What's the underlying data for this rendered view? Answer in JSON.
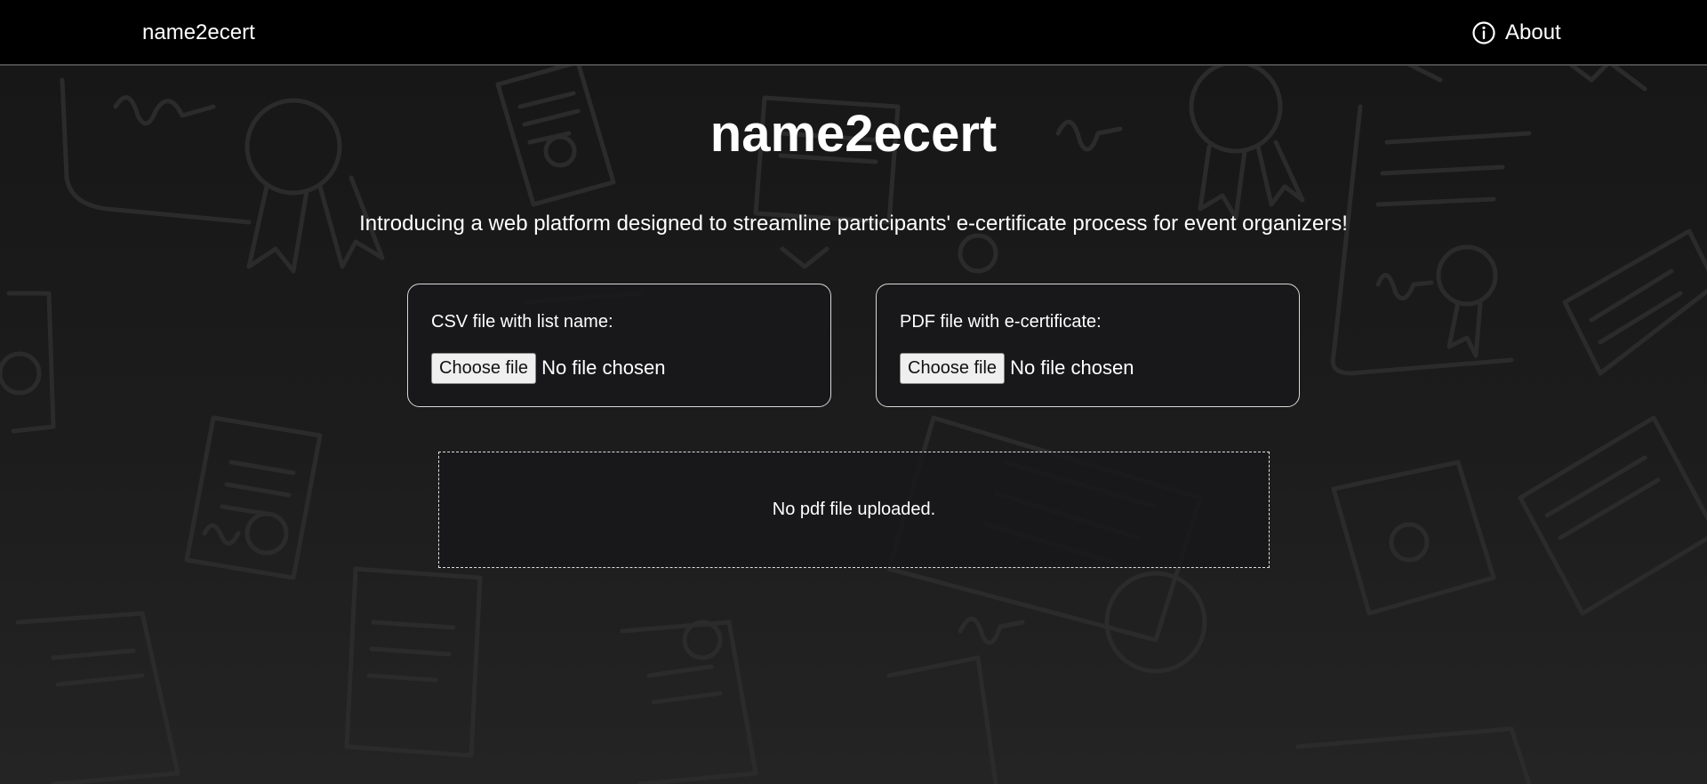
{
  "navbar": {
    "brand": "name2ecert",
    "about_label": "About",
    "about_icon": "info-circle-icon"
  },
  "hero": {
    "title": "name2ecert",
    "subtitle": "Introducing a web platform designed to streamline participants' e-certificate process for event organizers!"
  },
  "uploads": {
    "csv": {
      "label": "CSV file with list name:",
      "button": "Choose file",
      "status": "No file chosen"
    },
    "pdf": {
      "label": "PDF file with e-certificate:",
      "button": "Choose file",
      "status": "No file chosen"
    }
  },
  "preview": {
    "message": "No pdf file uploaded."
  },
  "colors": {
    "navbar_bg": "#000000",
    "page_bg": "#161616",
    "text": "#ffffff",
    "card_border": "#d8d8d8",
    "button_bg": "#efefef",
    "pattern_stroke": "#2b2b2b"
  }
}
